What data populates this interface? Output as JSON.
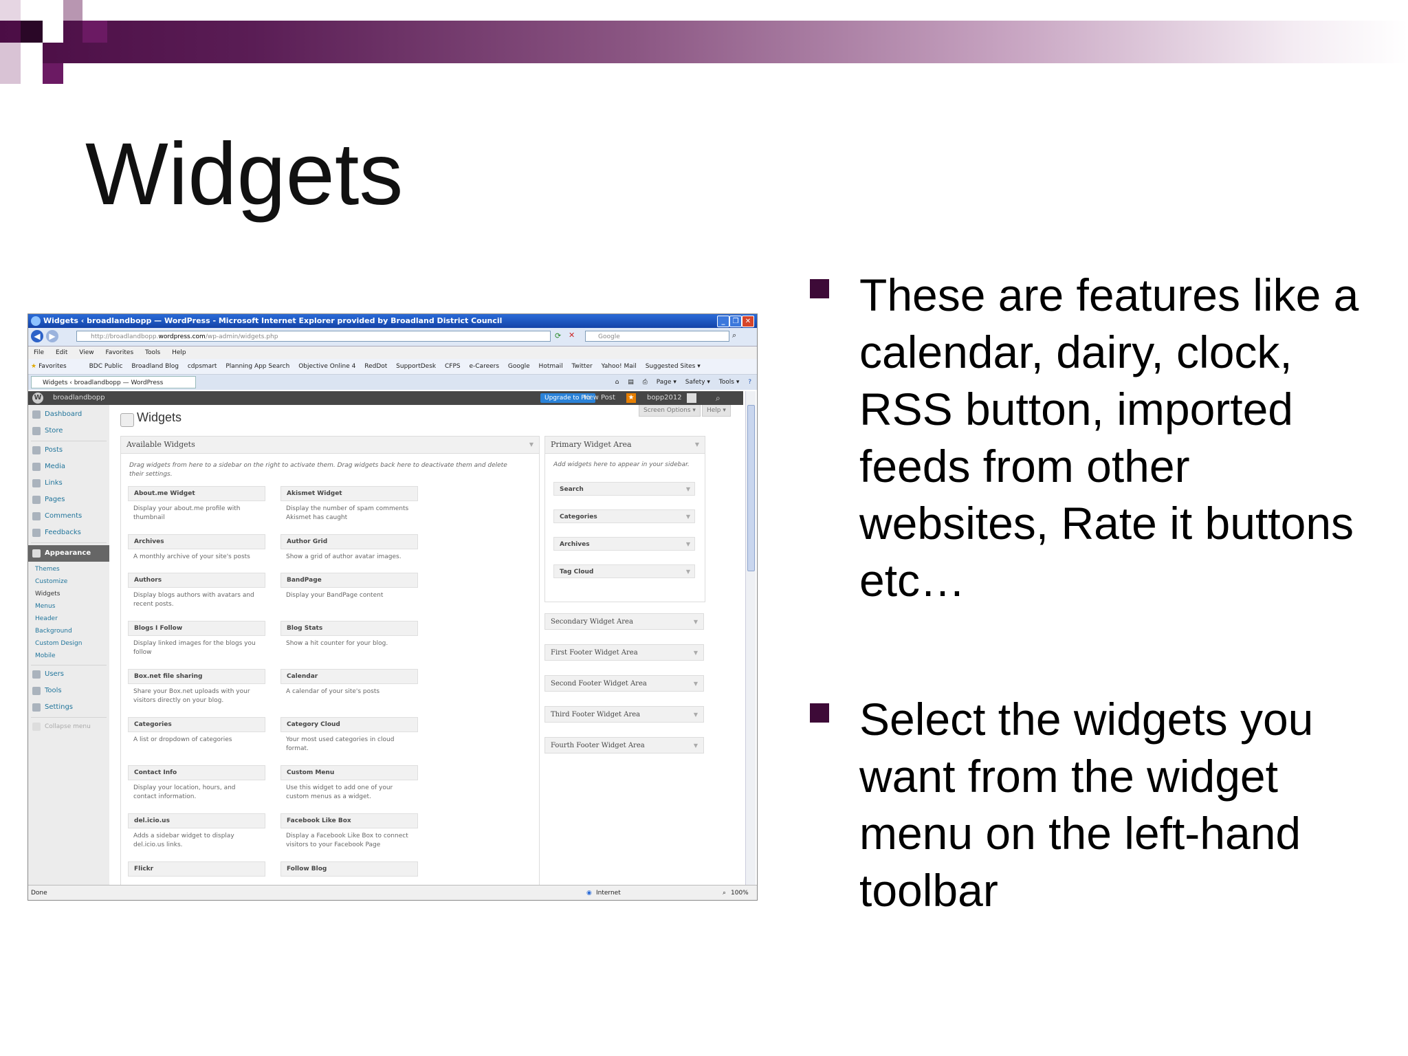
{
  "slide": {
    "title": "Widgets",
    "bullets": [
      "These are features like a calendar, dairy, clock, RSS button, imported feeds from other websites, Rate it buttons etc…",
      "Select the widgets you want from the widget menu on the left-hand toolbar"
    ],
    "colors": {
      "accent": "#4b0d45",
      "bullet": "#3d0a37"
    }
  },
  "browser": {
    "window_title": "Widgets ‹ broadlandbopp — WordPress - Microsoft Internet Explorer provided by Broadland District Council",
    "address_prefix": "http://broadlandbopp.",
    "address_domain": "wordpress.com",
    "address_suffix": "/wp-admin/widgets.php",
    "search_placeholder": "Google",
    "menu": [
      "File",
      "Edit",
      "View",
      "Favorites",
      "Tools",
      "Help"
    ],
    "favorites_label": "Favorites",
    "favorites": [
      "BDC Public",
      "Broadland Blog",
      "cdpsmart",
      "Planning App Search",
      "Objective Online 4",
      "RedDot",
      "SupportDesk",
      "CFPS",
      "e-Careers",
      "Google",
      "Hotmail",
      "Twitter",
      "Yahoo! Mail",
      "Suggested Sites ▾"
    ],
    "tab_title": "Widgets ‹ broadlandbopp — WordPress",
    "commands": [
      "Page ▾",
      "Safety ▾",
      "Tools ▾"
    ],
    "status_left": "Done",
    "status_zone": "Internet",
    "status_zoom": "100%"
  },
  "adminbar": {
    "site_name": "broadlandbopp",
    "upgrade_label": "Upgrade to Pro",
    "new_post_label": "New Post",
    "user_name": "bopp2012"
  },
  "sidebar": {
    "items": [
      {
        "label": "Dashboard"
      },
      {
        "label": "Store"
      },
      {
        "label": "Posts"
      },
      {
        "label": "Media"
      },
      {
        "label": "Links"
      },
      {
        "label": "Pages"
      },
      {
        "label": "Comments"
      },
      {
        "label": "Feedbacks"
      }
    ],
    "appearance_label": "Appearance",
    "appearance_sub": [
      "Themes",
      "Customize",
      "Widgets",
      "Menus",
      "Header",
      "Background",
      "Custom Design",
      "Mobile"
    ],
    "bottom_items": [
      {
        "label": "Users"
      },
      {
        "label": "Tools"
      },
      {
        "label": "Settings"
      }
    ],
    "collapse_label": "Collapse menu"
  },
  "main": {
    "heading": "Widgets",
    "screen_options": "Screen Options ▾",
    "help": "Help ▾",
    "available_title": "Available Widgets",
    "available_desc": "Drag widgets from here to a sidebar on the right to activate them. Drag widgets back here to deactivate them and delete their settings.",
    "widgets": [
      {
        "title": "About.me Widget",
        "desc": "Display your about.me profile with thumbnail"
      },
      {
        "title": "Akismet Widget",
        "desc": "Display the number of spam comments Akismet has caught"
      },
      {
        "title": "Archives",
        "desc": "A monthly archive of your site's posts"
      },
      {
        "title": "Author Grid",
        "desc": "Show a grid of author avatar images."
      },
      {
        "title": "Authors",
        "desc": "Display blogs authors with avatars and recent posts."
      },
      {
        "title": "BandPage",
        "desc": "Display your BandPage content"
      },
      {
        "title": "Blogs I Follow",
        "desc": "Display linked images for the blogs you follow"
      },
      {
        "title": "Blog Stats",
        "desc": "Show a hit counter for your blog."
      },
      {
        "title": "Box.net file sharing",
        "desc": "Share your Box.net uploads with your visitors directly on your blog."
      },
      {
        "title": "Calendar",
        "desc": "A calendar of your site's posts"
      },
      {
        "title": "Categories",
        "desc": "A list or dropdown of categories"
      },
      {
        "title": "Category Cloud",
        "desc": "Your most used categories in cloud format."
      },
      {
        "title": "Contact Info",
        "desc": "Display your location, hours, and contact information."
      },
      {
        "title": "Custom Menu",
        "desc": "Use this widget to add one of your custom menus as a widget."
      },
      {
        "title": "del.icio.us",
        "desc": "Adds a sidebar widget to display del.icio.us links."
      },
      {
        "title": "Facebook Like Box",
        "desc": "Display a Facebook Like Box to connect visitors to your Facebook Page"
      },
      {
        "title": "Flickr",
        "desc": ""
      },
      {
        "title": "Follow Blog",
        "desc": ""
      }
    ],
    "primary_title": "Primary Widget Area",
    "primary_desc": "Add widgets here to appear in your sidebar.",
    "primary_widgets": [
      "Search",
      "Categories",
      "Archives",
      "Tag Cloud"
    ],
    "other_areas": [
      "Secondary Widget Area",
      "First Footer Widget Area",
      "Second Footer Widget Area",
      "Third Footer Widget Area",
      "Fourth Footer Widget Area"
    ]
  }
}
